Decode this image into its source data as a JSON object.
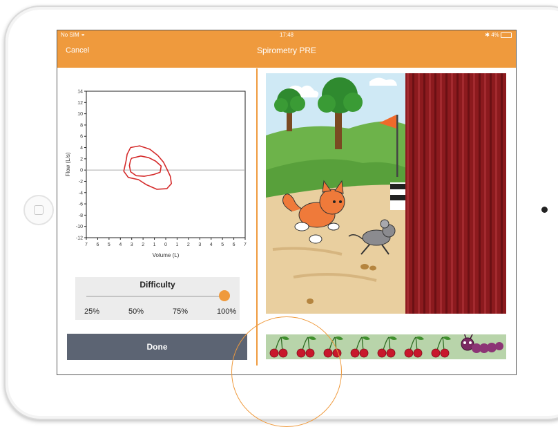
{
  "status_bar": {
    "carrier": "No SIM",
    "time": "17:48",
    "battery": "4%"
  },
  "nav": {
    "cancel_label": "Cancel",
    "title": "Spirometry PRE"
  },
  "chart_data": {
    "type": "line",
    "title": "",
    "xlabel": "Volume (L)",
    "ylabel": "Flow (L/s)",
    "xlim": [
      -7,
      7
    ],
    "ylim": [
      -12,
      14
    ],
    "x_ticks": [
      "7",
      "6",
      "5",
      "4",
      "3",
      "2",
      "1",
      "0",
      "1",
      "2",
      "3",
      "4",
      "5",
      "6",
      "7"
    ],
    "y_ticks": [
      "14",
      "12",
      "10",
      "8",
      "6",
      "4",
      "2",
      "0",
      "-2",
      "-4",
      "-6",
      "-8",
      "-10",
      "-12"
    ],
    "grid": false,
    "series": [
      {
        "color": "#d42a2a",
        "points": [
          [
            -3.1,
            4.0
          ],
          [
            -2.3,
            4.3
          ],
          [
            -1.4,
            3.7
          ],
          [
            -0.7,
            2.6
          ],
          [
            -0.2,
            1.4
          ],
          [
            0.1,
            0.2
          ],
          [
            0.4,
            -1.1
          ],
          [
            0.5,
            -2.4
          ],
          [
            0.1,
            -3.3
          ],
          [
            -0.8,
            -3.4
          ],
          [
            -1.7,
            -2.6
          ],
          [
            -2.4,
            -1.7
          ],
          [
            -3.3,
            -1.3
          ],
          [
            -3.7,
            -0.2
          ],
          [
            -3.5,
            1.6
          ],
          [
            -3.4,
            2.8
          ],
          [
            -3.2,
            3.6
          ]
        ]
      },
      {
        "color": "#d42a2a",
        "points": [
          [
            -3.0,
            2.1
          ],
          [
            -2.2,
            2.5
          ],
          [
            -1.5,
            2.2
          ],
          [
            -0.9,
            1.6
          ],
          [
            -0.4,
            0.7
          ],
          [
            -0.5,
            -0.4
          ],
          [
            -1.1,
            -0.8
          ],
          [
            -1.9,
            -1.1
          ],
          [
            -2.6,
            -1.0
          ],
          [
            -3.1,
            -0.3
          ],
          [
            -3.2,
            0.8
          ],
          [
            -3.1,
            1.8
          ]
        ]
      }
    ]
  },
  "difficulty": {
    "title": "Difficulty",
    "value": 1.0,
    "levels": [
      "25%",
      "50%",
      "75%",
      "100%"
    ]
  },
  "done_label": "Done",
  "game": {
    "progress": {
      "cherries_total": 7,
      "collected": 0
    },
    "colors": {
      "accent": "#ef9a3d",
      "curtain": "#8c1a1e",
      "grass": "#6db34a",
      "sky": "#cfe9f5"
    },
    "icons": [
      "cat-icon",
      "mouse-icon",
      "flag-icon",
      "tree-icon",
      "cherry-icon",
      "caterpillar-icon"
    ]
  }
}
